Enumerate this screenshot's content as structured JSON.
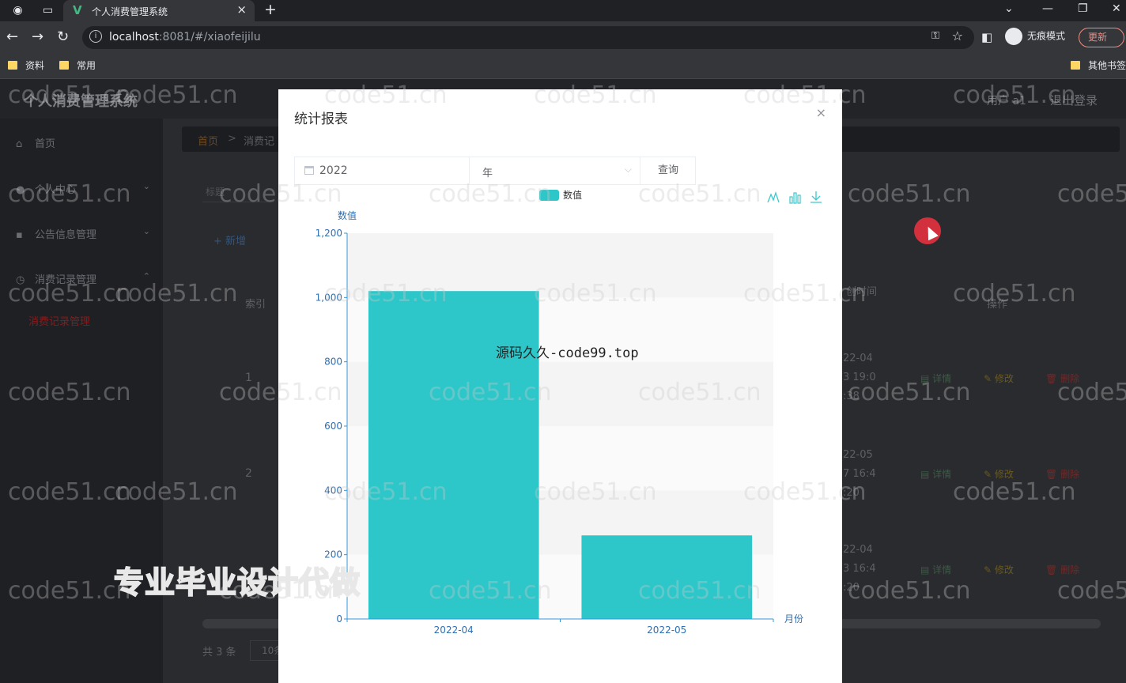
{
  "browser": {
    "tab_title": "个人消费管理系统",
    "url_host": "localhost",
    "url_rest": ":8081/#/xiaofeijilu",
    "incognito_label": "无痕模式",
    "update_label": "更新",
    "bookmarks": [
      "资料",
      "常用"
    ],
    "other_bookmarks": "其他书签"
  },
  "app": {
    "title": "个人消费管理系统",
    "user": "用户 a1",
    "logout": "退出登录",
    "sidebar": {
      "home": "首页",
      "personal": "个人中心",
      "notice": "公告信息管理",
      "consume": "消费记录管理",
      "consume_sub": "消费记录管理"
    },
    "breadcrumb": {
      "home": "首页",
      "sep": ">",
      "current": "消费记"
    },
    "search_placeholder": "标题",
    "add_label": "+ 新增",
    "table": {
      "col_index": "索引",
      "col_time": "创时间",
      "col_ops": "操作",
      "rows": [
        {
          "index": "1",
          "time_a": "22-04",
          "time_b": "3 19:0",
          "time_c": ":38"
        },
        {
          "index": "2",
          "time_a": "22-05",
          "time_b": "7 16:4",
          "time_c": ":20"
        },
        {
          "index": "",
          "time_a": "22-04",
          "time_b": "3 16:4",
          "time_c": ":20"
        }
      ],
      "op_detail": "详情",
      "op_edit": "修改",
      "op_delete": "删除"
    },
    "total": "共 3 条",
    "page_size": "10条"
  },
  "dialog": {
    "title": "统计报表",
    "close": "×",
    "filter_year": "2022",
    "filter_type": "年",
    "query_label": "查询"
  },
  "chart_data": {
    "type": "bar",
    "categories": [
      "2022-04",
      "2022-05"
    ],
    "series": [
      {
        "name": "数值",
        "values": [
          1020,
          260
        ]
      }
    ],
    "xlabel": "月份",
    "ylabel": "数值",
    "ylim": [
      0,
      1200
    ],
    "yticks": [
      0,
      200,
      400,
      600,
      800,
      1000,
      1200
    ],
    "bar_color": "#2ec7c9",
    "legend": "top-center",
    "toolbox": [
      "line-chart-icon",
      "bar-chart-icon",
      "download-icon"
    ]
  },
  "watermarks": {
    "site": "code51.cn",
    "source": "源码久久-code99.top",
    "ad": "专业毕业设计代做"
  }
}
